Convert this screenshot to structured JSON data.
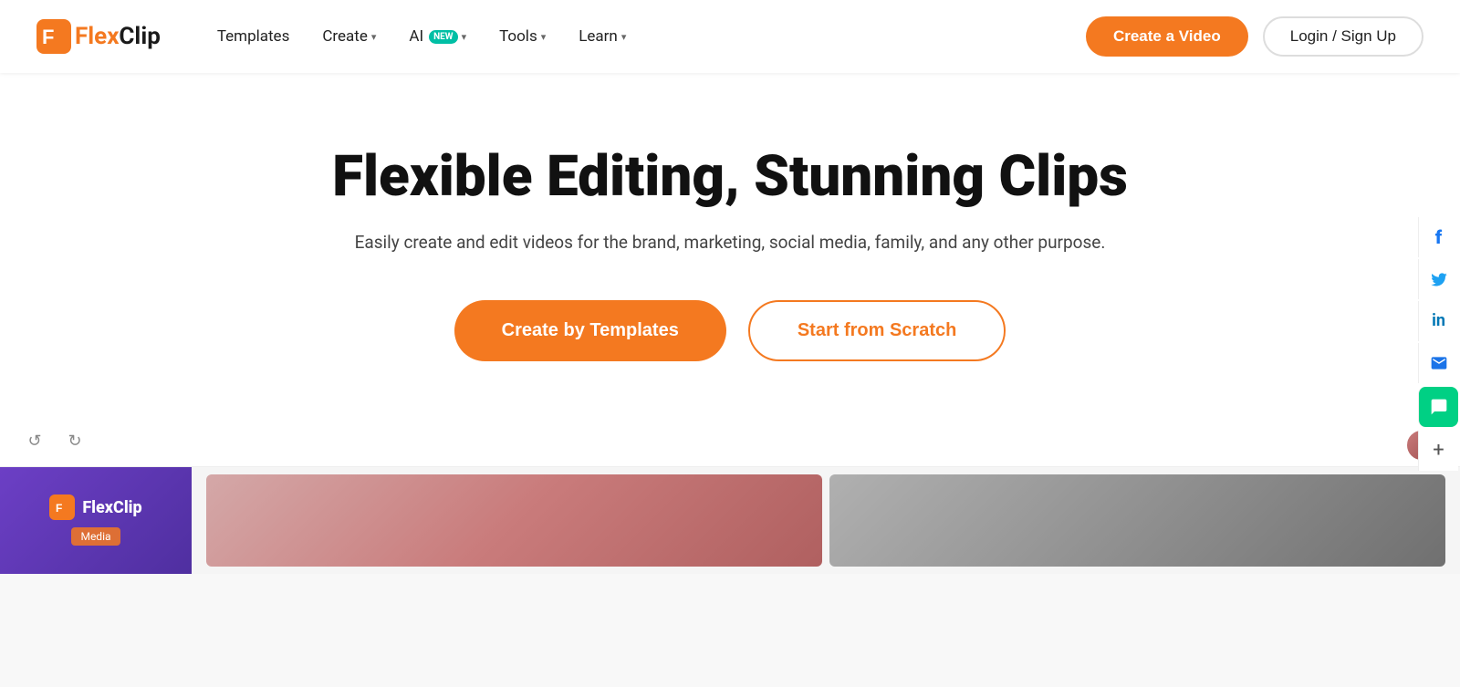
{
  "nav": {
    "logo_text": "FlexClip",
    "items": [
      {
        "label": "Templates",
        "has_dropdown": false
      },
      {
        "label": "Create",
        "has_dropdown": true
      },
      {
        "label": "AI",
        "has_dropdown": true,
        "badge": "NEW"
      },
      {
        "label": "Tools",
        "has_dropdown": true
      },
      {
        "label": "Learn",
        "has_dropdown": true
      }
    ],
    "cta_label": "Create a Video",
    "login_label": "Login / Sign Up"
  },
  "hero": {
    "title": "Flexible Editing, Stunning Clips",
    "subtitle": "Easily create and edit videos for the brand, marketing, social media, family, and any other purpose.",
    "btn_templates": "Create by Templates",
    "btn_scratch": "Start from Scratch"
  },
  "social": {
    "items": [
      {
        "name": "facebook",
        "label": "f"
      },
      {
        "name": "twitter",
        "label": "𝕏"
      },
      {
        "name": "linkedin",
        "label": "in"
      },
      {
        "name": "email",
        "label": "✉"
      },
      {
        "name": "chat",
        "label": "💬"
      },
      {
        "name": "more",
        "label": "+"
      }
    ]
  },
  "editor": {
    "undo_label": "↺",
    "redo_label": "↻",
    "sidebar_logo": "FlexClip",
    "media_label": "Media"
  }
}
